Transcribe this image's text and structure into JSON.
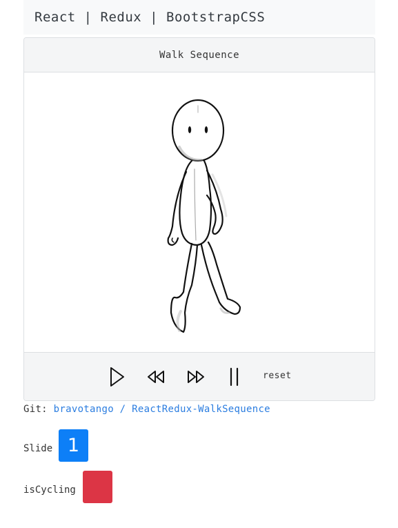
{
  "navbar": {
    "brand": "React | Redux | BootstrapCSS"
  },
  "card": {
    "title": "Walk Sequence",
    "image": {
      "description_icon": "stick-figure-walking"
    },
    "controls": {
      "play_icon": "play-icon",
      "rewind_icon": "rewind-icon",
      "fast_forward_icon": "fast-forward-icon",
      "pause_icon": "pause-icon",
      "reset_label": "reset"
    }
  },
  "git": {
    "prefix": "Git: ",
    "owner": "bravotango",
    "separator": " / ",
    "repo": "ReactRedux-WalkSequence"
  },
  "status": {
    "slide_label": "Slide",
    "slide_value": "1",
    "cycling_label": "isCycling",
    "cycling_color": "#dc3545",
    "slide_color": "#0d7ff7"
  }
}
